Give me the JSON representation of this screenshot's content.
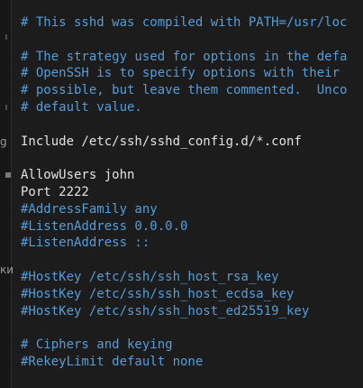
{
  "gutter": {
    "fragments": [
      "g",
      "▪",
      "ки"
    ]
  },
  "editor": {
    "lines": [
      {
        "text": "# This sshd was compiled with PATH=/usr/loc",
        "kind": "comment"
      },
      {
        "text": "",
        "kind": "blank"
      },
      {
        "text": "# The strategy used for options in the defa",
        "kind": "comment"
      },
      {
        "text": "# OpenSSH is to specify options with their",
        "kind": "comment"
      },
      {
        "text": "# possible, but leave them commented.  Unco",
        "kind": "comment"
      },
      {
        "text": "# default value.",
        "kind": "comment"
      },
      {
        "text": "",
        "kind": "blank"
      },
      {
        "text": "Include /etc/ssh/sshd_config.d/*.conf",
        "kind": "plain"
      },
      {
        "text": "",
        "kind": "blank"
      },
      {
        "text": "AllowUsers john",
        "kind": "plain"
      },
      {
        "text": "Port 2222",
        "kind": "plain"
      },
      {
        "text": "#AddressFamily any",
        "kind": "comment"
      },
      {
        "text": "#ListenAddress 0.0.0.0",
        "kind": "comment"
      },
      {
        "text": "#ListenAddress ::",
        "kind": "comment"
      },
      {
        "text": "",
        "kind": "blank"
      },
      {
        "text": "#HostKey /etc/ssh/ssh_host_rsa_key",
        "kind": "comment"
      },
      {
        "text": "#HostKey /etc/ssh/ssh_host_ecdsa_key",
        "kind": "comment"
      },
      {
        "text": "#HostKey /etc/ssh/ssh_host_ed25519_key",
        "kind": "comment"
      },
      {
        "text": "",
        "kind": "blank"
      },
      {
        "text": "# Ciphers and keying",
        "kind": "comment"
      },
      {
        "text": "#RekeyLimit default none",
        "kind": "comment"
      }
    ]
  },
  "colors": {
    "background": "#1c1c1c",
    "comment": "#569cd6",
    "plain_text": "#e2e2e2"
  }
}
